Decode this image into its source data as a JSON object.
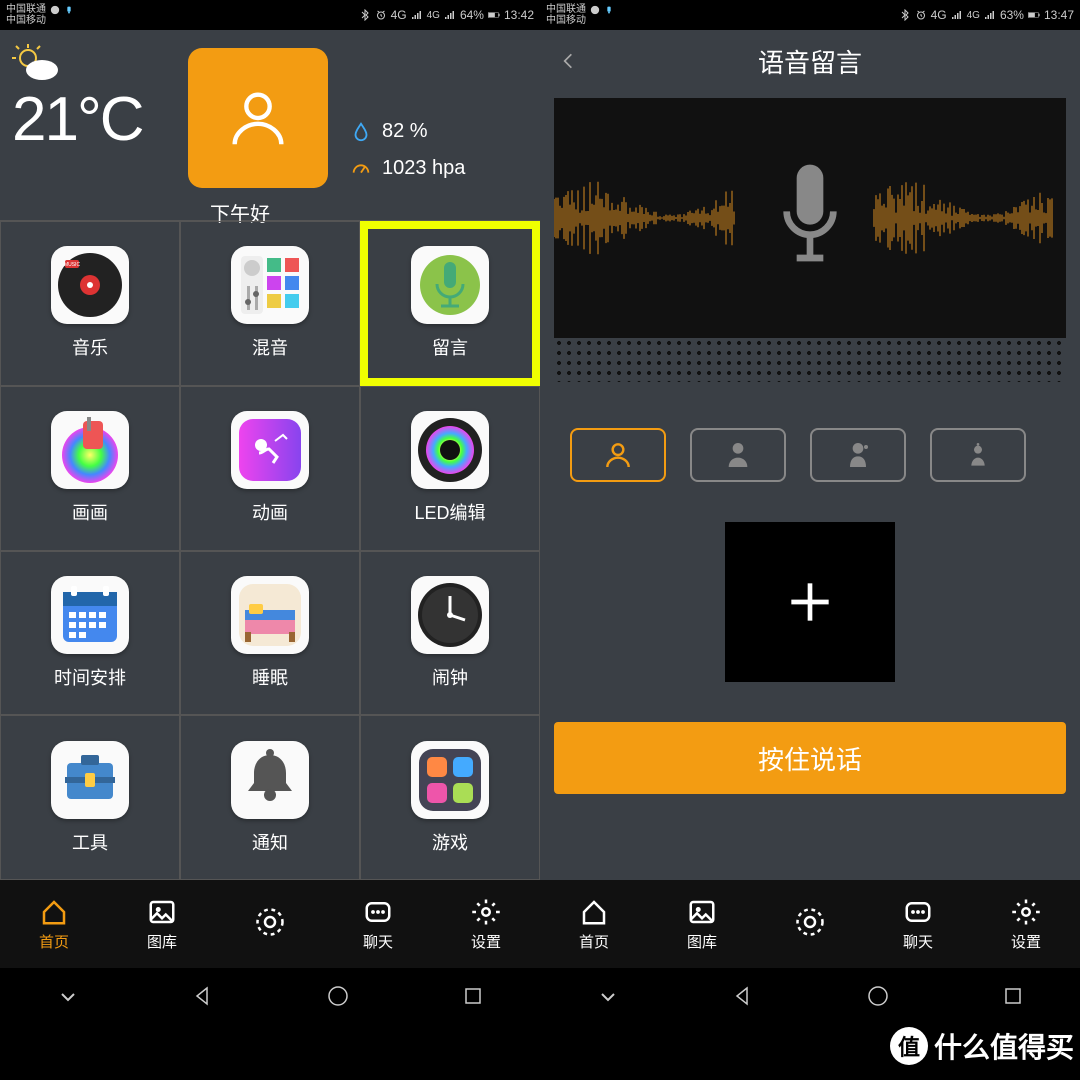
{
  "left": {
    "status": {
      "carrier1": "中国联通",
      "carrier2": "中国移动",
      "battery": "64%",
      "time": "13:42",
      "net": "4G"
    },
    "weather": {
      "temp": "21°C",
      "greeting": "下午好",
      "humidity": "82 %",
      "pressure": "1023 hpa"
    },
    "grid": [
      {
        "label": "音乐",
        "icon": "music"
      },
      {
        "label": "混音",
        "icon": "mixer"
      },
      {
        "label": "留言",
        "icon": "mic",
        "highlight": true
      },
      {
        "label": "画画",
        "icon": "paint"
      },
      {
        "label": "动画",
        "icon": "anim"
      },
      {
        "label": "LED编辑",
        "icon": "led"
      },
      {
        "label": "时间安排",
        "icon": "calendar"
      },
      {
        "label": "睡眠",
        "icon": "sleep"
      },
      {
        "label": "闹钟",
        "icon": "clock"
      },
      {
        "label": "工具",
        "icon": "tools"
      },
      {
        "label": "通知",
        "icon": "bell"
      },
      {
        "label": "游戏",
        "icon": "game"
      }
    ],
    "tabs": [
      {
        "label": "首页",
        "icon": "home",
        "active": true
      },
      {
        "label": "图库",
        "icon": "gallery"
      },
      {
        "label": "",
        "icon": "brightness"
      },
      {
        "label": "聊天",
        "icon": "chat"
      },
      {
        "label": "设置",
        "icon": "settings"
      }
    ]
  },
  "right": {
    "status": {
      "carrier1": "中国联通",
      "carrier2": "中国移动",
      "battery": "63%",
      "time": "13:47",
      "net": "4G"
    },
    "title": "语音留言",
    "record_button": "按住说话",
    "tabs": [
      {
        "label": "首页",
        "icon": "home"
      },
      {
        "label": "图库",
        "icon": "gallery"
      },
      {
        "label": "",
        "icon": "brightness"
      },
      {
        "label": "聊天",
        "icon": "chat"
      },
      {
        "label": "设置",
        "icon": "settings"
      }
    ]
  },
  "watermark": "什么值得买"
}
